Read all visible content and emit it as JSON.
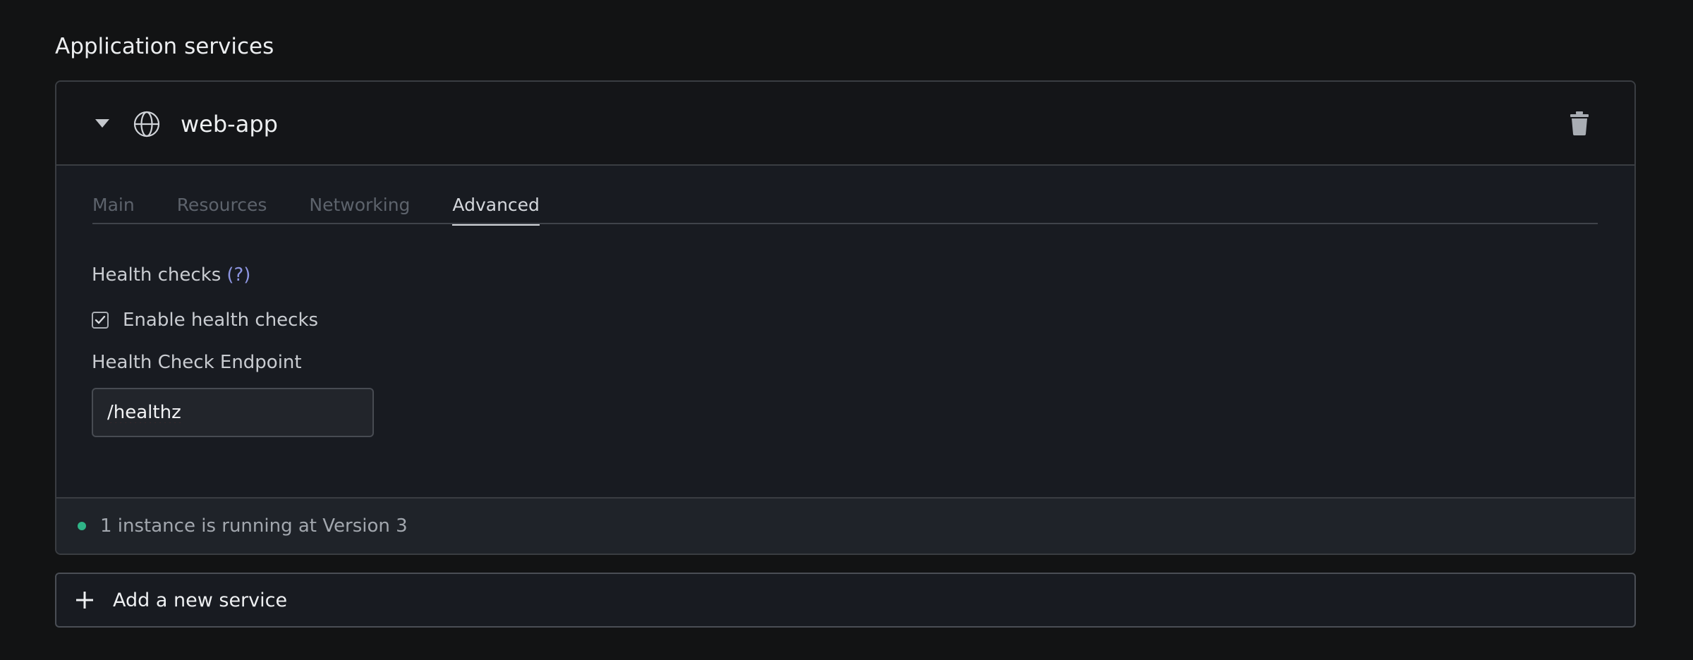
{
  "section": {
    "title": "Application services"
  },
  "service": {
    "name": "web-app",
    "icons": {
      "toggle": "chevron-down-icon",
      "type": "globe-icon",
      "delete": "trash-icon"
    },
    "tabs": [
      {
        "label": "Main",
        "active": false
      },
      {
        "label": "Resources",
        "active": false
      },
      {
        "label": "Networking",
        "active": false
      },
      {
        "label": "Advanced",
        "active": true
      }
    ],
    "advanced": {
      "health_checks_heading": "Health checks",
      "help_link": "(?)",
      "enable_checkbox_label": "Enable health checks",
      "enable_checked": true,
      "endpoint_label": "Health Check Endpoint",
      "endpoint_value": "/healthz"
    },
    "status": {
      "text": "1 instance is running at Version 3",
      "color": "#2fb487"
    }
  },
  "add_service": {
    "label": "Add a new service",
    "icon": "plus-icon"
  },
  "colors": {
    "background": "#121314",
    "card": "#181b21",
    "accent_link": "#8d95e0",
    "status_running": "#2fb487"
  }
}
